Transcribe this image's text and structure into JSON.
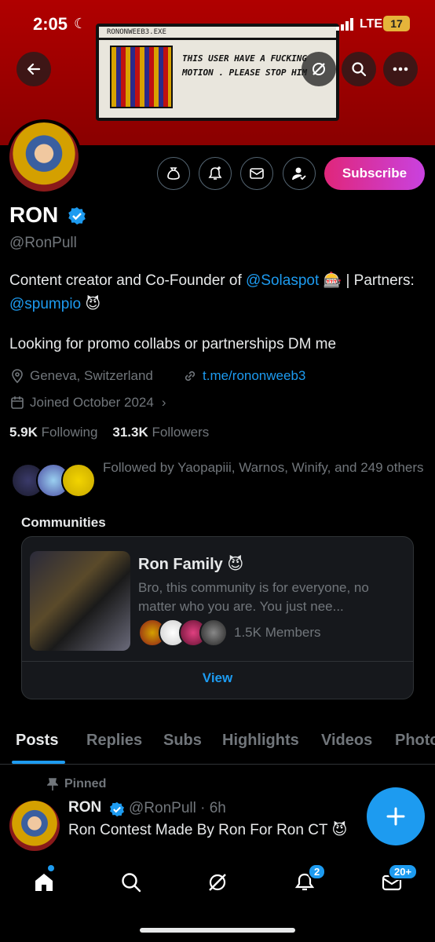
{
  "status_bar": {
    "time": "2:05",
    "network": "LTE",
    "battery": "17"
  },
  "banner": {
    "window_title": "RONONWEEB3.EXE",
    "caption": "THIS USER HAVE A FUCKING MOTION . PLEASE STOP HIM"
  },
  "profile": {
    "name": "RON",
    "handle": "@RonPull",
    "bio_prefix": "Content creator and Co-Founder of ",
    "bio_link1": "@Solaspot",
    "bio_mid": " 🎰 | Partners: ",
    "bio_link2": "@spumpio",
    "bio_suffix": " 😈",
    "bio_line2": "Looking for promo collabs or partnerships DM me",
    "location": "Geneva, Switzerland",
    "website": "t.me/rononweeb3",
    "joined": "Joined October 2024",
    "following_count": "5.9K",
    "following_label": "Following",
    "followers_count": "31.3K",
    "followers_label": "Followers",
    "followed_by": "Followed by Yaopapiii, Warnos, Winify, and 249 others",
    "subscribe_label": "Subscribe"
  },
  "communities": {
    "title": "Communities",
    "name": "Ron Family 😈",
    "description": "Bro, this community is for everyone, no matter who you are. You just nee...",
    "members": "1.5K Members",
    "view_label": "View"
  },
  "tabs": [
    "Posts",
    "Replies",
    "Subs",
    "Highlights",
    "Videos",
    "Photos"
  ],
  "post": {
    "pinned_label": "Pinned",
    "name": "RON",
    "handle_time": "@RonPull · 6h",
    "text": "Ron Contest Made By Ron For Ron CT 😈"
  },
  "nav": {
    "notifications_badge": "2",
    "messages_badge": "20+"
  },
  "colors": {
    "accent": "#1d9bf0",
    "banner": "#b00000",
    "subscribe_start": "#e0267a",
    "subscribe_end": "#c942e0"
  }
}
